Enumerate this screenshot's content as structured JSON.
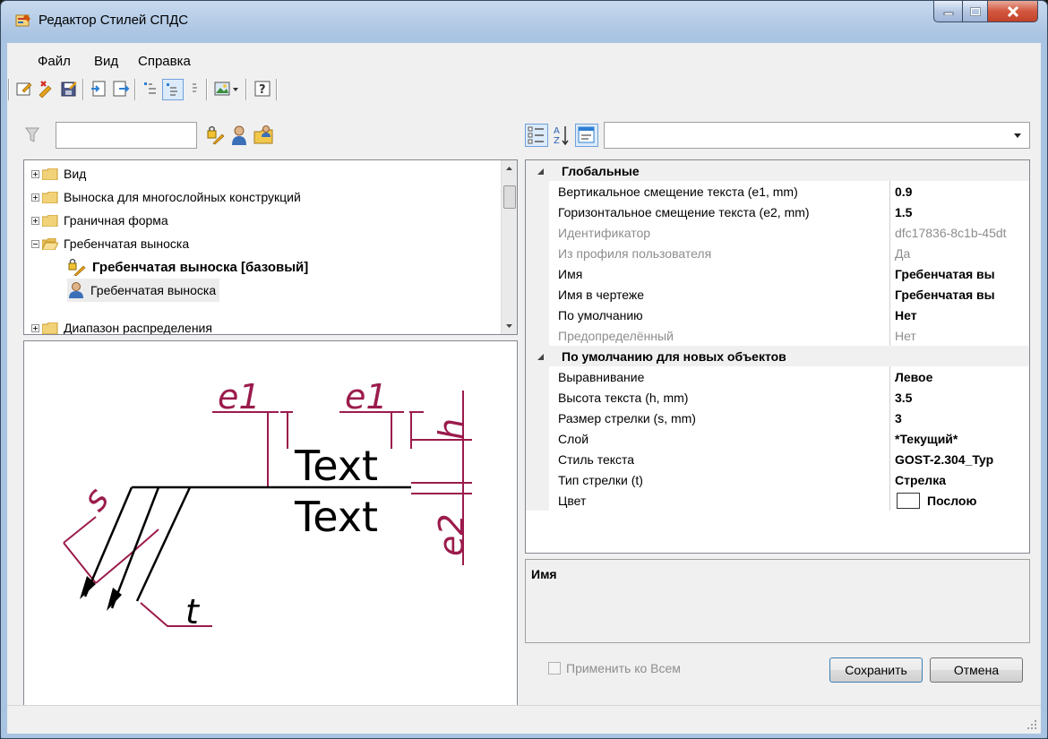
{
  "window": {
    "title": "Редактор Стилей СПДС"
  },
  "menu": {
    "items": [
      "Файл",
      "Вид",
      "Справка"
    ]
  },
  "toolbar": {
    "icons": [
      "new-style-icon",
      "delete-style-icon",
      "save-icon",
      "import-icon",
      "export-icon",
      "view-list-icon",
      "view-tree-icon",
      "view-details-icon",
      "preview-image-icon",
      "help-icon"
    ]
  },
  "filter": {
    "value": ""
  },
  "tree": {
    "items": [
      {
        "label": "Вид",
        "level": 0
      },
      {
        "label": "Выноска для многослойных конструкций",
        "level": 0
      },
      {
        "label": "Граничная форма",
        "level": 0
      },
      {
        "label": "Гребенчатая выноска",
        "level": 0
      },
      {
        "label": "Гребенчатая выноска [базовый]",
        "level": 1
      },
      {
        "label": "Гребенчатая выноска",
        "level": 1
      },
      {
        "label": "Диапазон распределения",
        "level": 0
      }
    ]
  },
  "preview": {
    "labels": {
      "e1": "e1",
      "h": "h",
      "s": "s",
      "t": "t",
      "e2": "e2",
      "text": "Text"
    }
  },
  "property_grid": {
    "dropdown_value": "",
    "categories": [
      {
        "name": "Глобальные",
        "rows": [
          {
            "name": "Вертикальное смещение текста (e1, mm)",
            "value": "0.9",
            "disabled": false
          },
          {
            "name": "Горизонтальное смещение текста (e2, mm)",
            "value": "1.5",
            "disabled": false
          },
          {
            "name": "Идентификатор",
            "value": "dfc17836-8c1b-45dt",
            "disabled": true
          },
          {
            "name": "Из профиля пользователя",
            "value": "Да",
            "disabled": true
          },
          {
            "name": "Имя",
            "value": "Гребенчатая вы",
            "disabled": false
          },
          {
            "name": "Имя в чертеже",
            "value": "Гребенчатая вы",
            "disabled": false
          },
          {
            "name": "По умолчанию",
            "value": "Нет",
            "disabled": false
          },
          {
            "name": "Предопределённый",
            "value": "Нет",
            "disabled": true
          }
        ]
      },
      {
        "name": "По умолчанию для новых объектов",
        "rows": [
          {
            "name": "Выравнивание",
            "value": "Левое",
            "disabled": false
          },
          {
            "name": "Высота текста (h, mm)",
            "value": "3.5",
            "disabled": false
          },
          {
            "name": "Размер стрелки (s, mm)",
            "value": "3",
            "disabled": false
          },
          {
            "name": "Слой",
            "value": "*Текущий*",
            "disabled": false
          },
          {
            "name": "Стиль текста",
            "value": "GOST-2.304_Typ",
            "disabled": false
          },
          {
            "name": "Тип стрелки (t)",
            "value": "Стрелка",
            "disabled": false
          },
          {
            "name": "Цвет",
            "value": "Послою",
            "disabled": false
          }
        ]
      }
    ]
  },
  "description": {
    "title": "Имя"
  },
  "footer": {
    "apply_all_label": "Применить ко Всем",
    "save_label": "Сохранить",
    "cancel_label": "Отмена"
  },
  "colors": {
    "accent": "#9b1b4c",
    "titlebar": "#b9d1ea"
  }
}
